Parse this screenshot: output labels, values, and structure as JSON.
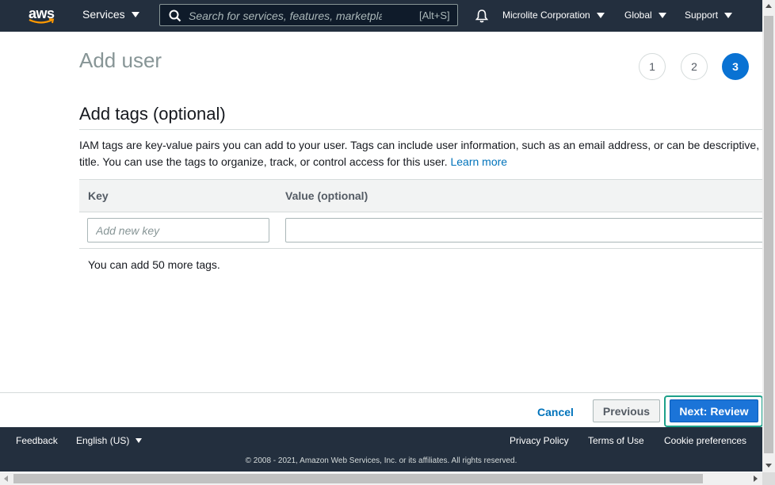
{
  "nav": {
    "logo_text": "aws",
    "services_label": "Services",
    "search_placeholder": "Search for services, features, marketplace products, and docs",
    "search_shortcut": "[Alt+S]",
    "account_label": "Microlite Corporation",
    "region_label": "Global",
    "support_label": "Support"
  },
  "page": {
    "title": "Add user",
    "steps": [
      "1",
      "2",
      "3"
    ],
    "active_step": "3"
  },
  "section": {
    "title": "Add tags (optional)",
    "description_line1": "IAM tags are key-value pairs you can add to your user. Tags can include user information, such as an email address, or can be descriptive, s",
    "description_line2": "title. You can use the tags to organize, track, or control access for this user.",
    "learn_more": "Learn more"
  },
  "tags_table": {
    "columns": [
      "Key",
      "Value (optional)"
    ],
    "key_placeholder": "Add new key",
    "key_value": "",
    "value_value": "",
    "remaining_text": "You can add 50 more tags."
  },
  "actions": {
    "cancel": "Cancel",
    "previous": "Previous",
    "next": "Next: Review"
  },
  "footer": {
    "feedback": "Feedback",
    "language": "English (US)",
    "privacy": "Privacy Policy",
    "terms": "Terms of Use",
    "cookies": "Cookie preferences",
    "copyright": "© 2008 - 2021, Amazon Web Services, Inc. or its affiliates. All rights reserved."
  },
  "colors": {
    "nav_bg": "#232f3e",
    "primary": "#1b74d8",
    "focus_ring": "#1da18a",
    "link": "#0073bb"
  }
}
